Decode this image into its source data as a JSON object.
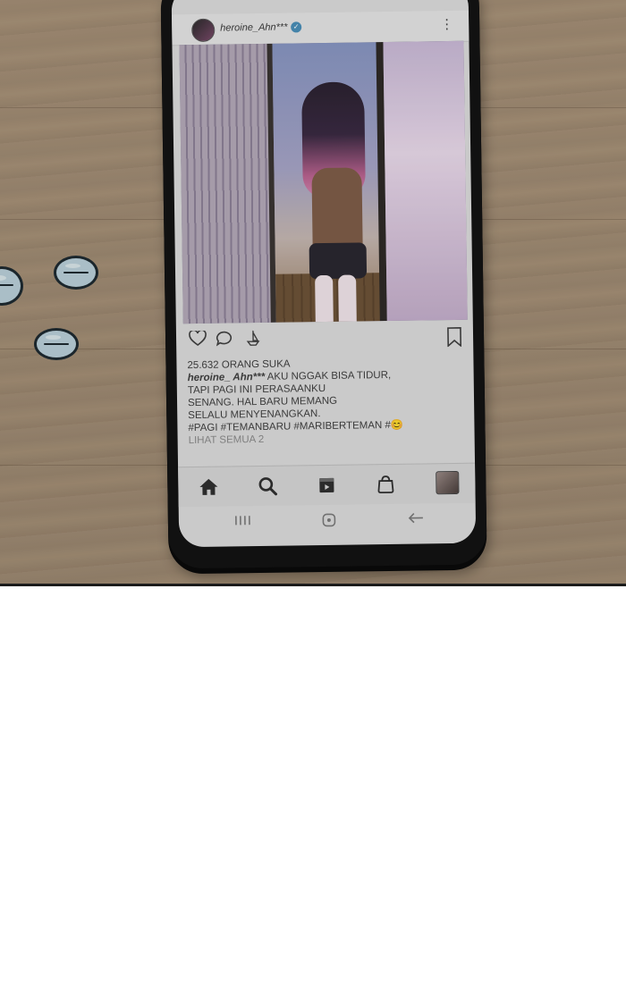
{
  "post": {
    "username": "heroine_Ahn***",
    "verified_mark": "✓",
    "more_menu": "⋮",
    "likes": "25.632 ORANG SUKA",
    "caption_user": "heroine_ Ahn***",
    "caption_lines": [
      "AKU NGGAK BISA TIDUR,",
      "TAPI PAGI INI PERASAANKU",
      "SENANG. HAL BARU MEMANG",
      "SELALU MENYENANGKAN.",
      "#PAGI #TEMANBARU #MARIBERTEMAN #😊"
    ],
    "view_all": "LIHAT SEMUA 2"
  },
  "icons": {
    "like": "heart-icon",
    "comment": "comment-icon",
    "share": "share-icon",
    "save": "bookmark-icon",
    "home": "home-icon",
    "search": "search-icon",
    "reels": "reels-icon",
    "shop": "shop-icon",
    "profile": "profile-avatar",
    "recent_apps": "recent-apps-icon",
    "system_home": "system-home-icon",
    "back": "back-icon"
  },
  "colors": {
    "table_wood": "#a48f77",
    "screen_bg": "#dcdcdc",
    "verified_blue": "#4a8fb8",
    "pill": "#b9cfd8"
  }
}
